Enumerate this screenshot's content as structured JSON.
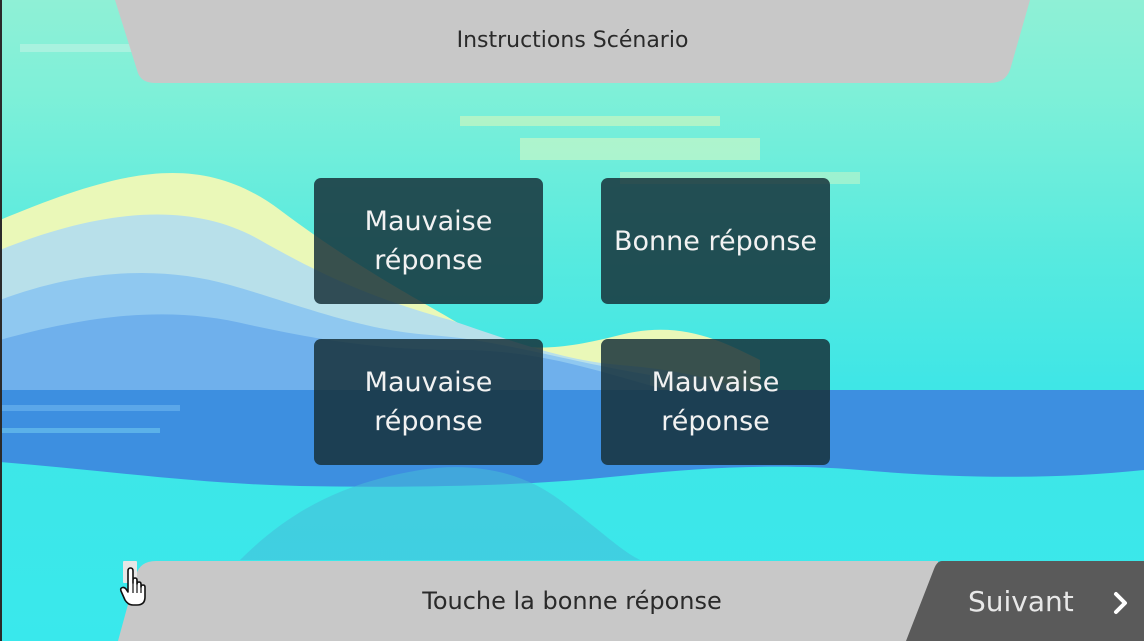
{
  "header": {
    "title": "Instructions Scénario"
  },
  "answers": [
    {
      "label": "Mauvaise réponse"
    },
    {
      "label": "Bonne réponse"
    },
    {
      "label": "Mauvaise réponse"
    },
    {
      "label": "Mauvaise réponse"
    }
  ],
  "footer": {
    "instruction": "Touche la bonne réponse",
    "hint_icon": "hand-pointer-icon",
    "next_label": "Suivant",
    "next_icon": "chevron-right-icon"
  },
  "colors": {
    "banner": "#c8c8c8",
    "next_button": "#5a5a5a",
    "answer_button": "#163038",
    "sky": "#7ff0d8",
    "sea": "#3a8fe0"
  }
}
